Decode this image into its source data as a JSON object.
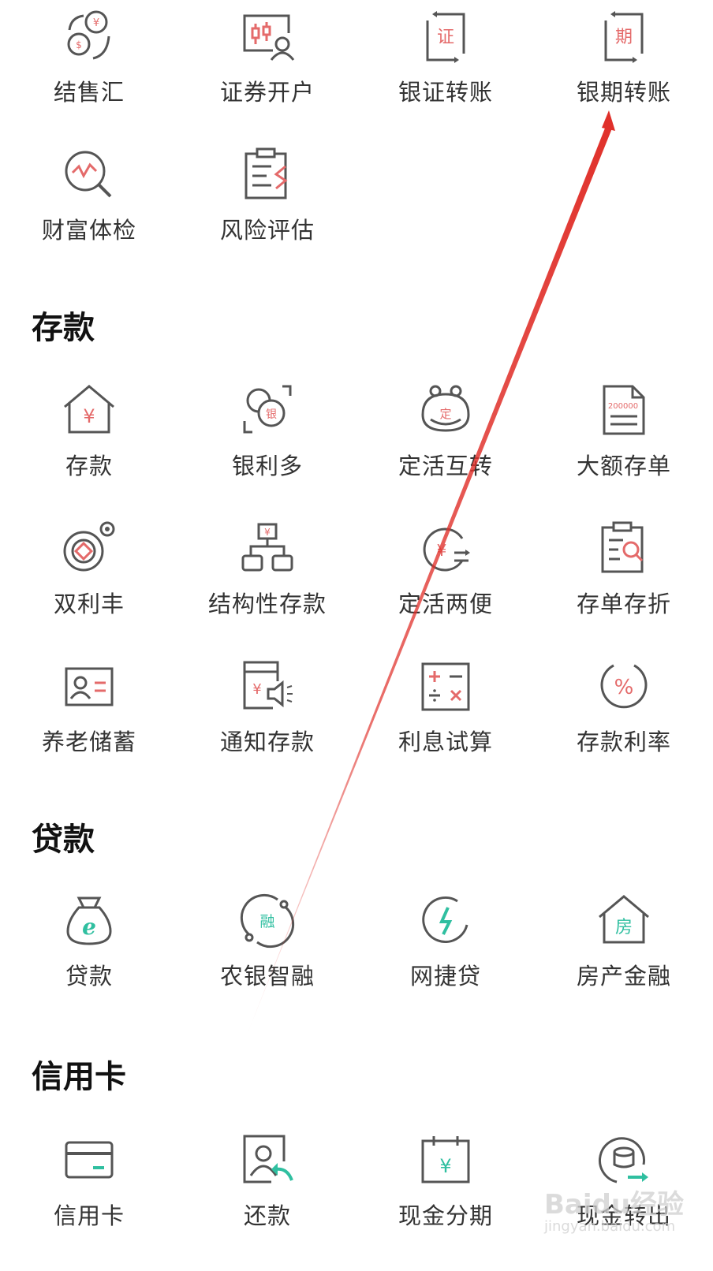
{
  "colors": {
    "icon_gray": "#555555",
    "accent_red": "#e46a6a",
    "accent_green": "#2fbfa0",
    "arrow_red": "#e0302a"
  },
  "top_items": [
    {
      "label": "结售汇",
      "icon": "currency-exchange-icon"
    },
    {
      "label": "证券开户",
      "icon": "securities-account-icon"
    },
    {
      "label": "银证转账",
      "icon": "bank-securities-transfer-icon",
      "glyph": "证"
    },
    {
      "label": "银期转账",
      "icon": "bank-futures-transfer-icon",
      "glyph": "期"
    },
    {
      "label": "财富体检",
      "icon": "wealth-checkup-icon"
    },
    {
      "label": "风险评估",
      "icon": "risk-assessment-icon"
    }
  ],
  "deposit": {
    "title": "存款",
    "items": [
      {
        "label": "存款",
        "icon": "deposit-house-icon"
      },
      {
        "label": "银利多",
        "icon": "yinliduo-icon",
        "glyph": "银"
      },
      {
        "label": "定活互转",
        "icon": "fixed-current-swap-icon",
        "glyph": "定"
      },
      {
        "label": "大额存单",
        "icon": "large-deposit-certificate-icon",
        "glyph": "200000"
      },
      {
        "label": "双利丰",
        "icon": "shuanglifeng-icon"
      },
      {
        "label": "结构性存款",
        "icon": "structured-deposit-icon"
      },
      {
        "label": "定活两便",
        "icon": "fixed-current-flexible-icon"
      },
      {
        "label": "存单存折",
        "icon": "passbook-search-icon"
      },
      {
        "label": "养老储蓄",
        "icon": "pension-savings-icon"
      },
      {
        "label": "通知存款",
        "icon": "notice-deposit-icon"
      },
      {
        "label": "利息试算",
        "icon": "interest-calculator-icon"
      },
      {
        "label": "存款利率",
        "icon": "deposit-rate-icon"
      }
    ]
  },
  "loan": {
    "title": "贷款",
    "items": [
      {
        "label": "贷款",
        "icon": "loan-bag-icon"
      },
      {
        "label": "农银智融",
        "icon": "nongyin-zhirong-icon",
        "glyph": "融"
      },
      {
        "label": "网捷贷",
        "icon": "wangjiedai-icon"
      },
      {
        "label": "房产金融",
        "icon": "property-finance-icon",
        "glyph": "房"
      }
    ]
  },
  "credit_card": {
    "title": "信用卡",
    "items": [
      {
        "label": "信用卡",
        "icon": "credit-card-icon"
      },
      {
        "label": "还款",
        "icon": "repayment-icon"
      },
      {
        "label": "现金分期",
        "icon": "cash-installment-icon"
      },
      {
        "label": "现金转出",
        "icon": "cash-transfer-out-icon"
      }
    ]
  },
  "watermark": {
    "brand": "Baidu经验",
    "domain": "jingyan.baidu.com"
  }
}
